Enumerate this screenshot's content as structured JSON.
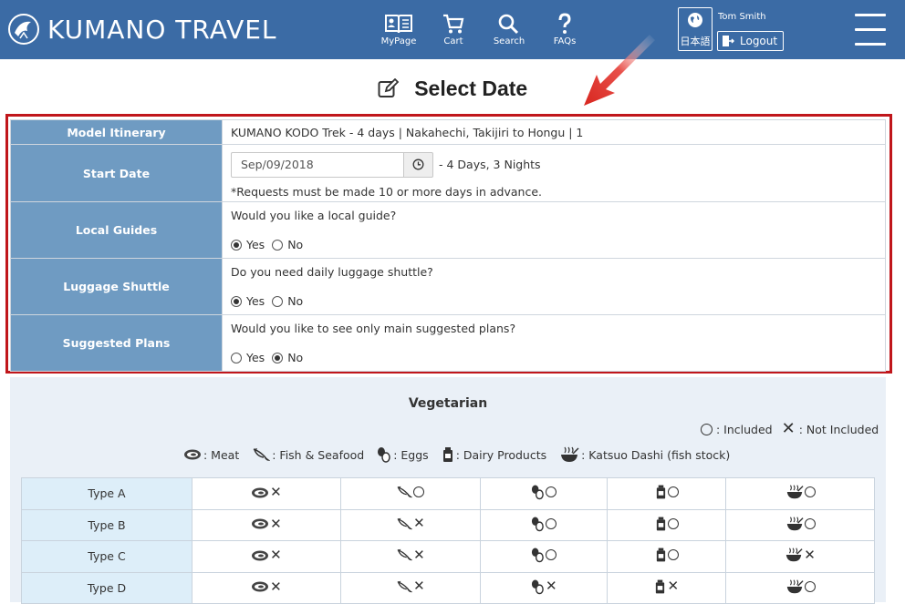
{
  "header": {
    "brand": "KUMANO TRAVEL",
    "nav": [
      {
        "label": "MyPage",
        "icon": "book-icon"
      },
      {
        "label": "Cart",
        "icon": "cart-icon"
      },
      {
        "label": "Search",
        "icon": "search-icon"
      },
      {
        "label": "FAQs",
        "icon": "question-icon"
      }
    ],
    "language_label": "日本語",
    "user_name": "Tom Smith",
    "logout_label": "Logout"
  },
  "page": {
    "title": "Select Date"
  },
  "form": {
    "itinerary_label": "Model Itinerary",
    "itinerary_value": "KUMANO KODO Trek - 4 days | Nakahechi, Takijiri to Hongu | 1",
    "start_date_label": "Start Date",
    "start_date_value": "Sep/09/2018",
    "duration": "- 4 Days, 3 Nights",
    "advance_note": "*Requests must be made 10 or more days in advance.",
    "questions": [
      {
        "label": "Local Guides",
        "question": "Would you like a local guide?",
        "selected": "Yes"
      },
      {
        "label": "Luggage Shuttle",
        "question": "Do you need daily luggage shuttle?",
        "selected": "Yes"
      },
      {
        "label": "Suggested Plans",
        "question": "Would you like to see only main suggested plans?",
        "selected": "No"
      }
    ],
    "yes_label": "Yes",
    "no_label": "No"
  },
  "vegetarian": {
    "title": "Vegetarian",
    "legend_included": ": Included",
    "legend_not_included": ": Not Included",
    "keys": [
      {
        "icon": "meat-icon",
        "label": ": Meat"
      },
      {
        "icon": "fish-icon",
        "label": ": Fish & Seafood"
      },
      {
        "icon": "eggs-icon",
        "label": ": Eggs"
      },
      {
        "icon": "dairy-icon",
        "label": ": Dairy Products"
      },
      {
        "icon": "dashi-icon",
        "label": ": Katsuo Dashi (fish stock)"
      }
    ],
    "rows": [
      {
        "type": "Type A",
        "values": [
          false,
          true,
          true,
          true,
          true
        ]
      },
      {
        "type": "Type B",
        "values": [
          false,
          false,
          true,
          true,
          true
        ]
      },
      {
        "type": "Type C",
        "values": [
          false,
          false,
          true,
          true,
          false
        ]
      },
      {
        "type": "Type D",
        "values": [
          false,
          false,
          false,
          false,
          true
        ]
      }
    ]
  },
  "colors": {
    "header_bg": "#3b6ba5",
    "label_bg": "#6f9bc2",
    "highlight_border": "#c0161b",
    "panel_bg": "#eaf0f7"
  }
}
